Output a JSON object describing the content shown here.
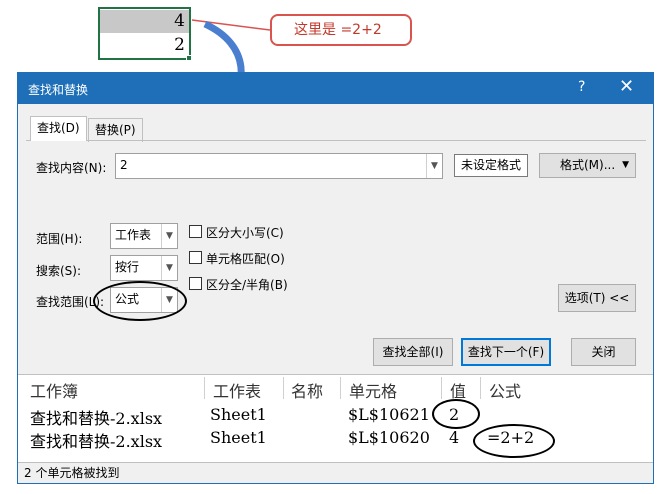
{
  "sheet": {
    "cell_values": [
      "4",
      "2"
    ]
  },
  "callout": {
    "text": "这里是  =2+2"
  },
  "dialog": {
    "title": "查找和替换",
    "help": "?",
    "close": "✕",
    "tabs": [
      {
        "label": "查找(D)",
        "active": true
      },
      {
        "label": "替换(P)",
        "active": false
      }
    ],
    "find_label": "查找内容(N):",
    "find_value": "2",
    "format_status": "未设定格式",
    "format_button": "格式(M)...",
    "scope_label": "范围(H):",
    "scope_value": "工作表",
    "search_label": "搜索(S):",
    "search_value": "按行",
    "lookin_label": "查找范围(L):",
    "lookin_value": "公式",
    "options": [
      {
        "label": "区分大小写(C)",
        "checked": false
      },
      {
        "label": "单元格匹配(O)",
        "checked": false
      },
      {
        "label": "区分全/半角(B)",
        "checked": false
      }
    ],
    "options_button": "选项(T) <<",
    "find_all": "查找全部(I)",
    "find_next": "查找下一个(F)",
    "close_button": "关闭",
    "results": {
      "headers": [
        "工作簿",
        "工作表",
        "名称",
        "单元格",
        "值",
        "公式"
      ],
      "rows": [
        {
          "book": "查找和替换-2.xlsx",
          "sheet": "Sheet1",
          "name": "",
          "cell": "$L$10621",
          "value": "2",
          "formula": ""
        },
        {
          "book": "查找和替换-2.xlsx",
          "sheet": "Sheet1",
          "name": "",
          "cell": "$L$10620",
          "value": "4",
          "formula": "=2+2"
        }
      ]
    },
    "status": "2 个单元格被找到"
  },
  "colors": {
    "titlebar": "#1e6fb8",
    "annotation_red": "#d9534f",
    "excel_green": "#217346",
    "arrow_blue": "#4a7fd0"
  }
}
